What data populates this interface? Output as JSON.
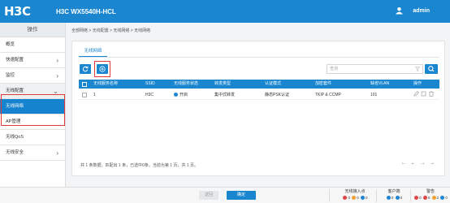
{
  "header": {
    "logo": "H3C",
    "device": "H3C WX5540H-HCL",
    "user": "admin"
  },
  "sidebar": {
    "title": "操作",
    "items": [
      {
        "label": "概览"
      },
      {
        "label": "快速配置"
      },
      {
        "label": "监控"
      },
      {
        "label": "无线配置"
      },
      {
        "label": "无线网络"
      },
      {
        "label": "AP管理"
      },
      {
        "label": "无线QoS"
      },
      {
        "label": "无线安全"
      }
    ]
  },
  "breadcrumb": "全部网络 > 无线配置 > 无线网络 > 无线网络",
  "tab": "无线网络",
  "search": {
    "placeholder": "查询"
  },
  "table": {
    "columns": [
      "无线服务名称",
      "SSID",
      "无线服务状态",
      "转发类型",
      "认证模式",
      "加密套件",
      "缺省VLAN",
      "操作"
    ],
    "rows": [
      {
        "name": "1",
        "ssid": "H3C",
        "status": "开启",
        "forward": "集中式转发",
        "auth": "静态PSK认证",
        "cipher": "TKIP & CCMP",
        "vlan": "101"
      }
    ]
  },
  "pager": {
    "text": "共 1 条数据，匹配出 1 条，已选中0条。当前为第 1 页，共 1 页。",
    "nav": "← ← → →"
  },
  "footer": {
    "prev": "返回",
    "next": "确定",
    "wireless_ap": {
      "label": "无线接入点",
      "values": [
        "0",
        "0",
        "0"
      ]
    },
    "clients": {
      "label": "客户端",
      "values": [
        "0",
        "0"
      ]
    },
    "alarms": {
      "label": "警告",
      "values": [
        "0",
        "0",
        "2",
        "0"
      ]
    }
  },
  "colors": {
    "primary": "#1a86d0",
    "highlight": "#e03a3a"
  }
}
